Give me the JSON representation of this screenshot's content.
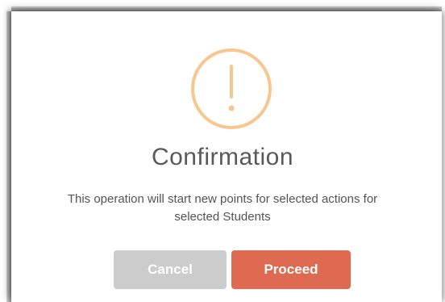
{
  "dialog": {
    "icon": "warning-exclamation-icon",
    "icon_color": "#f6c890",
    "title": "Confirmation",
    "message_line1": "This operation will start new points for selected actions for",
    "message_line2": "selected Students",
    "cancel_label": "Cancel",
    "proceed_label": "Proceed",
    "cancel_color": "#cccccc",
    "proceed_color": "#df6a52"
  }
}
